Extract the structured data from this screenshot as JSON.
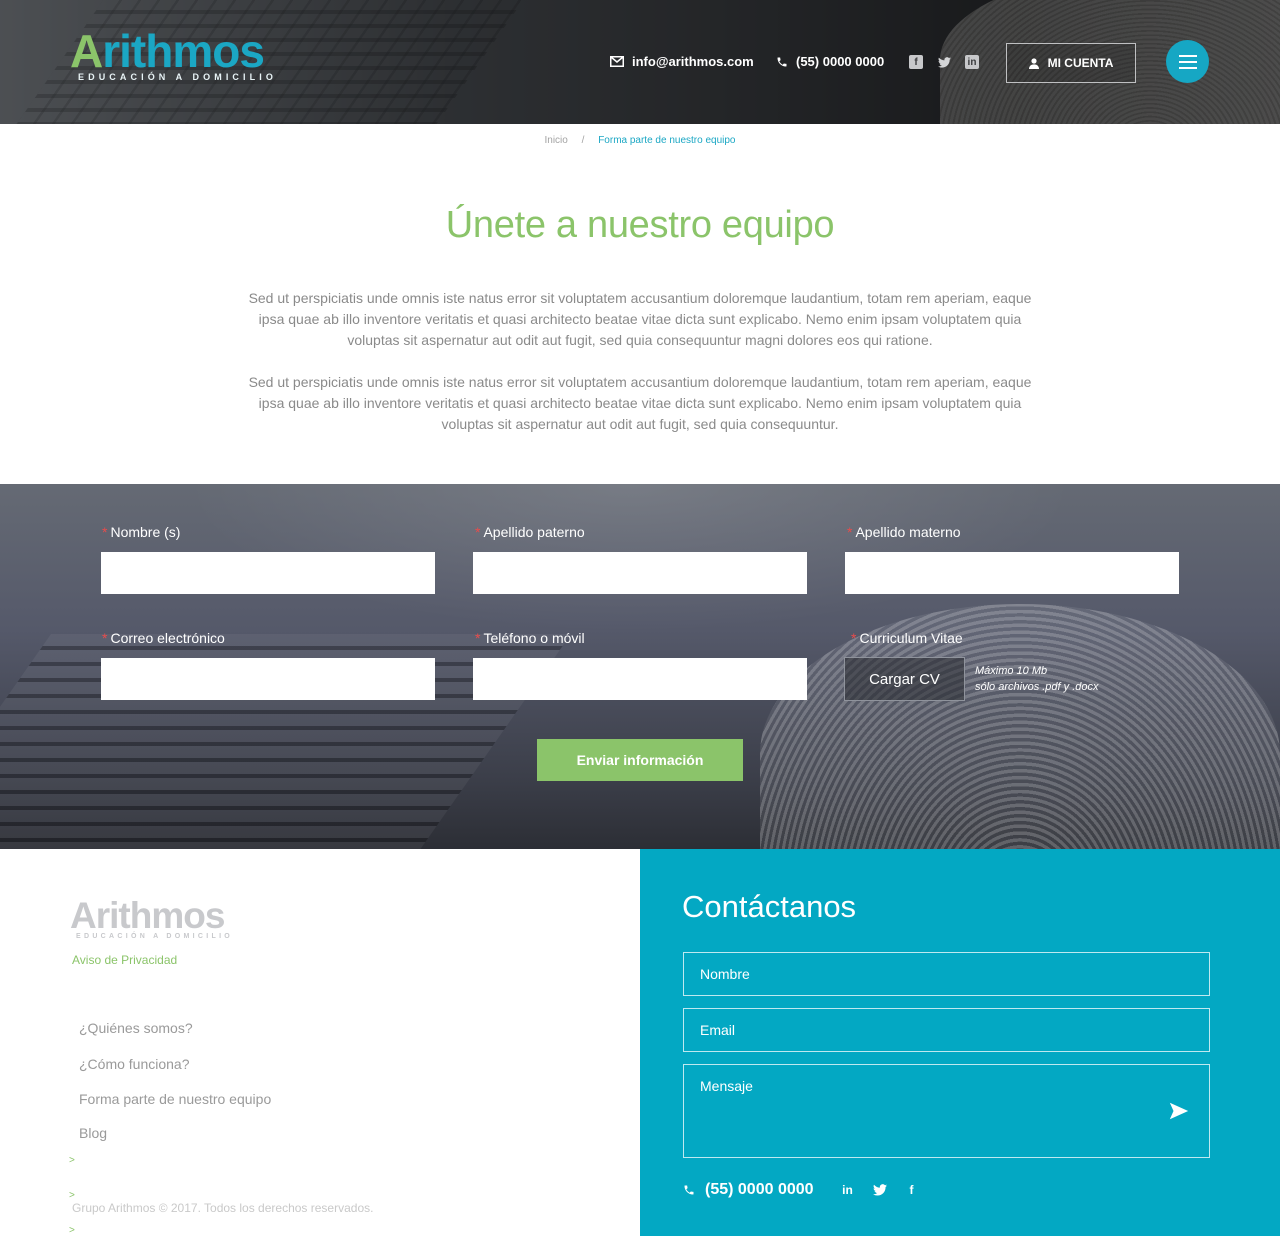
{
  "header": {
    "logo": {
      "word": "Arithmos",
      "tagline": "EDUCACIÓN A DOMICILIO"
    },
    "email": "info@arithmos.com",
    "phone": "(55) 0000 0000",
    "socials": [
      "facebook-icon",
      "twitter-icon",
      "linkedin-icon"
    ],
    "account_label": "MI CUENTA",
    "menu_icon": "hamburger-icon"
  },
  "breadcrumb": {
    "home": "Inicio",
    "separator": "/",
    "current": "Forma parte de nuestro equipo"
  },
  "intro": {
    "title": "Únete a nuestro equipo",
    "paragraph_1": "Sed ut perspiciatis unde omnis iste natus error sit voluptatem accusantium doloremque laudantium, totam rem aperiam, eaque ipsa quae ab illo inventore veritatis et quasi architecto beatae vitae dicta sunt explicabo. Nemo enim ipsam voluptatem quia voluptas sit aspernatur aut odit aut fugit, sed quia consequuntur magni dolores eos qui ratione.",
    "paragraph_2": "Sed ut perspiciatis unde omnis iste natus error sit voluptatem accusantium doloremque laudantium, totam rem aperiam, eaque ipsa quae ab illo inventore veritatis et quasi architecto beatae vitae dicta sunt explicabo. Nemo enim ipsam voluptatem quia voluptas sit aspernatur aut odit aut fugit, sed quia consequuntur."
  },
  "form": {
    "required_mark": "*",
    "fields": {
      "first_name": {
        "label": "Nombre (s)",
        "value": ""
      },
      "paternal_surname": {
        "label": "Apellido paterno",
        "value": ""
      },
      "maternal_surname": {
        "label": "Apellido materno",
        "value": ""
      },
      "email": {
        "label": "Correo electrónico",
        "value": ""
      },
      "phone": {
        "label": "Teléfono o móvil",
        "value": ""
      },
      "cv": {
        "label": "Curriculum Vitae"
      }
    },
    "cv_button": "Cargar CV",
    "cv_note_1": "Máximo 10 Mb",
    "cv_note_2": "sólo archivos .pdf y .docx",
    "submit": "Enviar información"
  },
  "footer": {
    "logo": {
      "word": "Arithmos",
      "tagline": "EDUCACIÓN A DOMICILIO"
    },
    "privacy": "Aviso de Privacidad",
    "nav": [
      "¿Quiénes somos?",
      "¿Cómo funciona?",
      "Forma parte de nuestro equipo",
      "Blog"
    ],
    "arrow": ">",
    "copyright": "Grupo Arithmos © 2017. Todos los derechos reservados."
  },
  "contact": {
    "title": "Contáctanos",
    "name_placeholder": "Nombre",
    "email_placeholder": "Email",
    "message_placeholder": "Mensaje",
    "phone": "(55) 0000 0000",
    "socials": [
      "linkedin-icon",
      "twitter-icon",
      "facebook-icon"
    ]
  },
  "colors": {
    "brand_blue": "#03a8c3",
    "brand_green": "#8bc46a",
    "required": "#e94c4c"
  }
}
